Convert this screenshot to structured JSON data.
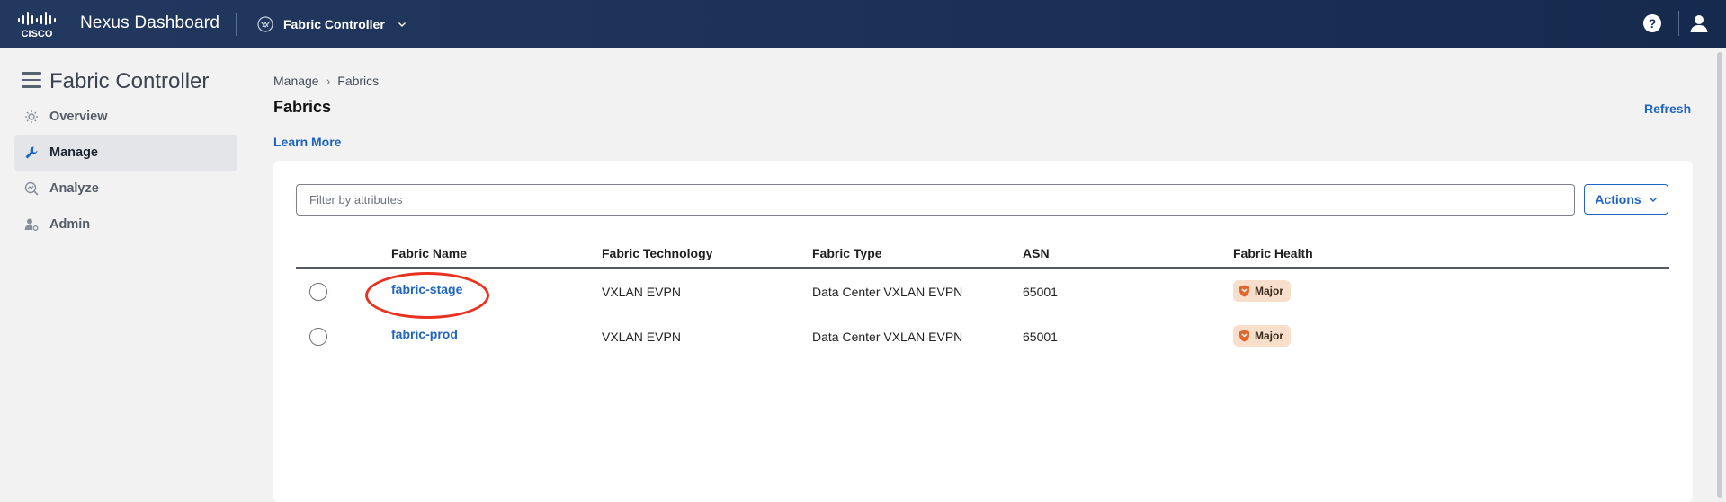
{
  "topbar": {
    "logo_text": "CISCO",
    "product_name": "Nexus Dashboard",
    "app_switcher_label": "Fabric Controller",
    "help_glyph": "?"
  },
  "sidebar": {
    "title": "Fabric Controller",
    "items": [
      {
        "label": "Overview",
        "icon": "overview-icon",
        "active": false
      },
      {
        "label": "Manage",
        "icon": "manage-icon",
        "active": true
      },
      {
        "label": "Analyze",
        "icon": "analyze-icon",
        "active": false
      },
      {
        "label": "Admin",
        "icon": "admin-icon",
        "active": false
      }
    ]
  },
  "breadcrumb": {
    "items": [
      "Manage",
      "Fabrics"
    ],
    "separator": "›"
  },
  "page": {
    "title": "Fabrics",
    "refresh_label": "Refresh",
    "learn_more_label": "Learn More"
  },
  "toolbar": {
    "filter_placeholder": "Filter by attributes",
    "filter_value": "",
    "actions_label": "Actions"
  },
  "table": {
    "columns": [
      "Fabric Name",
      "Fabric Technology",
      "Fabric Type",
      "ASN",
      "Fabric Health"
    ],
    "rows": [
      {
        "name": "fabric-stage",
        "technology": "VXLAN EVPN",
        "type": "Data Center VXLAN EVPN",
        "asn": "65001",
        "health": "Major",
        "highlighted": true
      },
      {
        "name": "fabric-prod",
        "technology": "VXLAN EVPN",
        "type": "Data Center VXLAN EVPN",
        "asn": "65001",
        "health": "Major",
        "highlighted": false
      }
    ]
  },
  "colors": {
    "topbar": "#1b3056",
    "accent": "#1d64c4",
    "health_major_bg": "#f8dfcb",
    "health_major_icon": "#e0662c",
    "highlight_ring": "#e8321f"
  }
}
